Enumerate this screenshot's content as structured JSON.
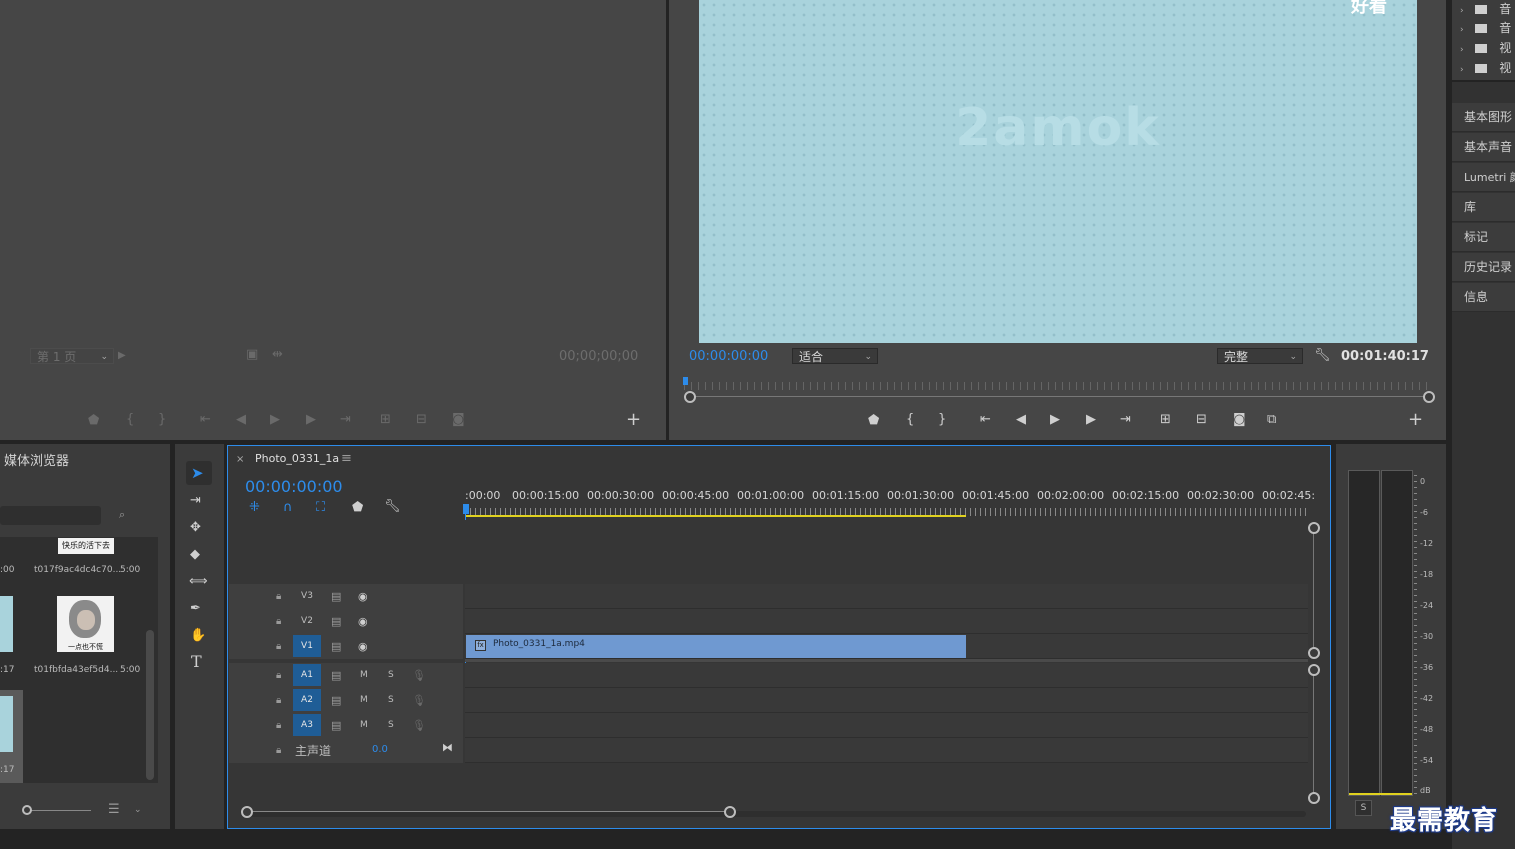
{
  "source_monitor": {
    "page_selector": "第 1 页",
    "timecode": "00;00;00;00"
  },
  "program_monitor": {
    "watermark": "2amok",
    "corner_text": "好看",
    "timecode": "00:00:00:00",
    "fit_dropdown": "适合",
    "quality_dropdown": "完整",
    "duration": "00:01:40:17"
  },
  "project_panel": {
    "folders": [
      "音",
      "音",
      "视",
      "视"
    ]
  },
  "right_panels": [
    "基本图形",
    "基本声音",
    "Lumetri 颜色",
    "库",
    "标记",
    "历史记录",
    "信息"
  ],
  "media_browser": {
    "title": "媒体浏览器",
    "items": [
      {
        "name": "t017f9ac4dc4c70...",
        "duration": "5:00",
        "caption": "快乐的活下去"
      },
      {
        "name": "t01fbfda43ef5d4...",
        "duration": "5:00",
        "caption": "一点也不慌"
      }
    ],
    "left_durations": [
      ":00",
      ":17",
      ":17"
    ]
  },
  "timeline": {
    "tab_close": "×",
    "sequence_name": "Photo_0331_1a",
    "timecode": "00:00:00:00",
    "ruler_labels": [
      ":00:00",
      "00:00:15:00",
      "00:00:30:00",
      "00:00:45:00",
      "00:01:00:00",
      "00:01:15:00",
      "00:01:30:00",
      "00:01:45:00",
      "00:02:00:00",
      "00:02:15:00",
      "00:02:30:00",
      "00:02:45:"
    ],
    "video_tracks": [
      "V3",
      "V2",
      "V1"
    ],
    "audio_tracks": [
      "A1",
      "A2",
      "A3"
    ],
    "mute_label": "M",
    "solo_label": "S",
    "master_label": "主声道",
    "master_value": "0.0",
    "clip_name": "Photo_0331_1a.mp4"
  },
  "audio_meter": {
    "scale": [
      "0",
      "-6",
      "-12",
      "-18",
      "-24",
      "-30",
      "-36",
      "-42",
      "-48",
      "-54",
      "dB"
    ],
    "solo_button": "S"
  },
  "logo_text": "最需教育",
  "colors": {
    "accent_blue": "#2d8ceb",
    "clip_blue": "#6f99d1",
    "work_area_yellow": "#e1d21f",
    "track_selected": "#1f5d96"
  }
}
